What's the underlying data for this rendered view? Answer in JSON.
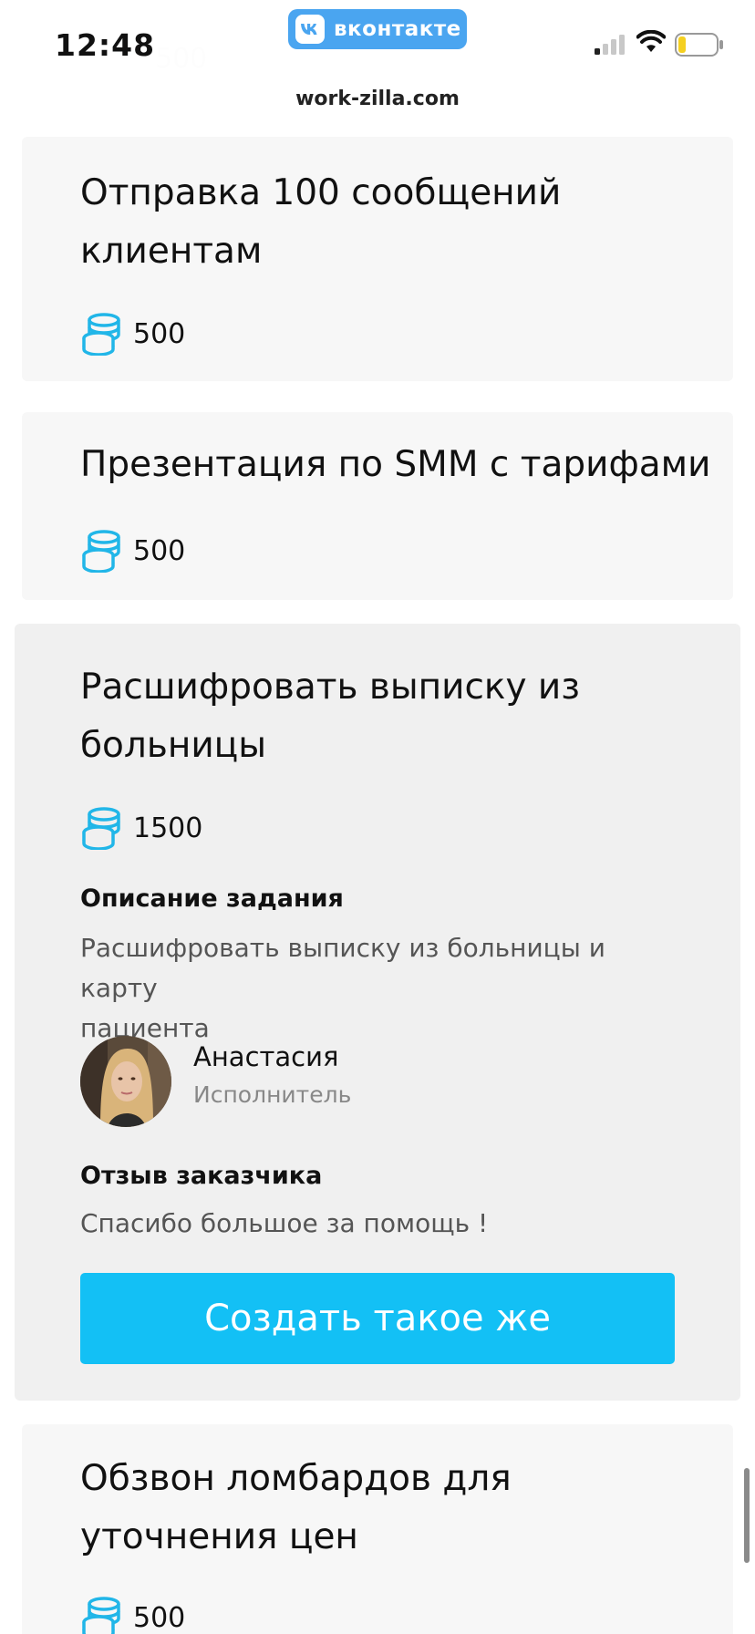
{
  "status_bar": {
    "time": "12:48",
    "app_badge": "вконтакте",
    "url": "work-zilla.com"
  },
  "top_card": {
    "price": "500"
  },
  "tasks": [
    {
      "title_lines": [
        "Отправка 100 сообщений",
        "клиентам"
      ],
      "price": "500"
    },
    {
      "title_lines": [
        "Презентация по SMM с тарифами"
      ],
      "price": "500"
    },
    {
      "title_lines": [
        "Расшифровать выписку из",
        "больницы"
      ],
      "price": "1500",
      "description_heading": "Описание задания",
      "description_lines": [
        "Расшифровать выписку из больницы и карту",
        "пациента"
      ],
      "performer": {
        "name": "Анастасия",
        "role": "Исполнитель"
      },
      "review_heading": "Отзыв заказчика",
      "review_text": "Спасибо большое за помощь !",
      "button_label": "Создать такое же"
    },
    {
      "title_lines": [
        "Обзвон ломбардов для",
        "уточнения цен"
      ],
      "price": "500"
    }
  ],
  "icons": {
    "coins": "coins-icon",
    "vk": "vk-logo-icon",
    "signal": "cellular-signal-icon",
    "wifi": "wifi-icon",
    "battery": "battery-icon"
  },
  "colors": {
    "accent": "#13c0f5",
    "coin": "#21b6e8",
    "vk_badge": "#4aa5f0",
    "battery_low": "#f5d020"
  }
}
